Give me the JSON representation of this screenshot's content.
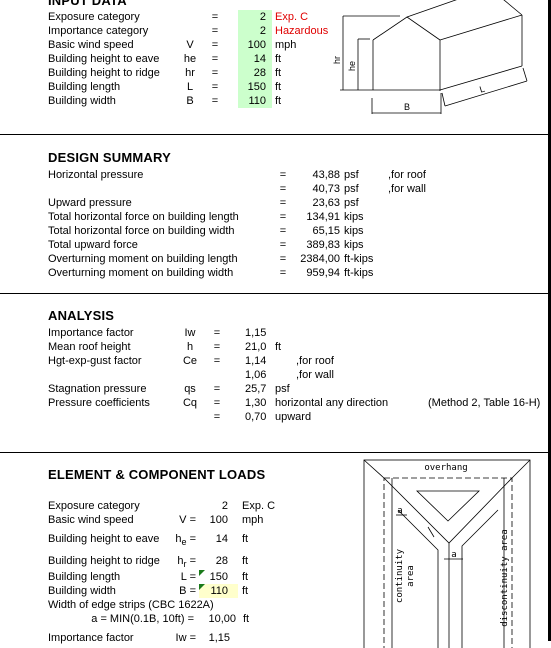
{
  "input": {
    "title": "INPUT DATA",
    "rows": [
      {
        "label": "Exposure category",
        "sym": "",
        "eq": "=",
        "value": "2",
        "unit": "Exp. C",
        "unit_red": true
      },
      {
        "label": "Importance category",
        "sym": "",
        "eq": "=",
        "value": "2",
        "unit": "Hazardous",
        "unit_red": true
      },
      {
        "label": "Basic wind speed",
        "sym": "V",
        "eq": "=",
        "value": "100",
        "unit": "mph"
      },
      {
        "label": "Building height to eave",
        "sym": "he",
        "eq": "=",
        "value": "14",
        "unit": "ft"
      },
      {
        "label": "Building height to ridge",
        "sym": "hr",
        "eq": "=",
        "value": "28",
        "unit": "ft"
      },
      {
        "label": "Building length",
        "sym": "L",
        "eq": "=",
        "value": "150",
        "unit": "ft"
      },
      {
        "label": "Building width",
        "sym": "B",
        "eq": "=",
        "value": "110",
        "unit": "ft"
      }
    ],
    "diagram": {
      "hr": "hr",
      "he": "he",
      "B": "B",
      "L": "L"
    }
  },
  "summary": {
    "title": "DESIGN SUMMARY",
    "rows": [
      {
        "label": "Horizontal pressure",
        "eq": "=",
        "value": "43,88",
        "unit": "psf",
        "note": ",for roof"
      },
      {
        "label": "",
        "eq": "=",
        "value": "40,73",
        "unit": "psf",
        "note": ",for wall"
      },
      {
        "label": "Upward pressure",
        "eq": "=",
        "value": "23,63",
        "unit": "psf",
        "note": ""
      },
      {
        "label": "Total horizontal force on building length",
        "eq": "=",
        "value": "134,91",
        "unit": "kips",
        "note": ""
      },
      {
        "label": "Total horizontal force on building width",
        "eq": "=",
        "value": "65,15",
        "unit": "kips",
        "note": ""
      },
      {
        "label": "Total upward force",
        "eq": "=",
        "value": "389,83",
        "unit": "kips",
        "note": ""
      },
      {
        "label": "Overturning moment on building length",
        "eq": "=",
        "value": "2384,00",
        "unit": "ft-kips",
        "note": ""
      },
      {
        "label": "Overturning moment on building width",
        "eq": "=",
        "value": "959,94",
        "unit": "ft-kips",
        "note": ""
      }
    ]
  },
  "analysis": {
    "title": "ANALYSIS",
    "rows": [
      {
        "label": "Importance factor",
        "sym": "Iw",
        "eq": "=",
        "value": "1,15",
        "unit": ""
      },
      {
        "label": "Mean roof height",
        "sym": "h",
        "eq": "=",
        "value": "21,0",
        "unit": "ft"
      },
      {
        "label": "Hgt-exp-gust factor",
        "sym": "Ce",
        "eq": "=",
        "value": "1,14",
        "unit": ",for roof"
      },
      {
        "label": "",
        "sym": "",
        "eq": "",
        "value": "1,06",
        "unit": ",for wall"
      },
      {
        "label": "Stagnation pressure",
        "sym": "qs",
        "eq": "=",
        "value": "25,7",
        "unit": "psf"
      },
      {
        "label": "Pressure coefficients",
        "sym": "Cq",
        "eq": "=",
        "value": "1,30",
        "unit": "horizontal any direction"
      },
      {
        "label": "",
        "sym": "",
        "eq": "=",
        "value": "0,70",
        "unit": "upward"
      }
    ],
    "method_note": "(Method 2, Table 16-H)"
  },
  "ecl": {
    "title": "ELEMENT & COMPONENT LOADS",
    "rows": [
      {
        "label": "Exposure category",
        "sym": "",
        "value": "2",
        "unit": "Exp. C"
      },
      {
        "label": "Basic wind speed",
        "sym": "V =",
        "value": "100",
        "unit": "mph"
      },
      {
        "label": "Building height to eave",
        "sym": "h",
        "sub": "e",
        "symeq": " =",
        "value": "14",
        "unit": "ft"
      },
      {
        "label": "Building height to ridge",
        "sym": "h",
        "sub": "r",
        "symeq": " =",
        "value": "28",
        "unit": "ft"
      },
      {
        "label": "Building length",
        "sym": "L =",
        "value": "150",
        "unit": "ft"
      },
      {
        "label": "Building width",
        "sym": "B =",
        "value": "110",
        "unit": "ft"
      }
    ],
    "edge_label": "Width of edge strips (CBC 1622A)",
    "edge_formula": "a = MIN(0.1B, 10ft) =",
    "edge_value": "10,00",
    "edge_unit": "ft",
    "imp_label": "Importance factor",
    "imp_sym": "Iw =",
    "imp_value": "1,15",
    "diagram": {
      "overhang": "overhang",
      "continuity": "continuity",
      "area": "area",
      "discontinuity": "discontinuity area",
      "a": "a"
    }
  }
}
